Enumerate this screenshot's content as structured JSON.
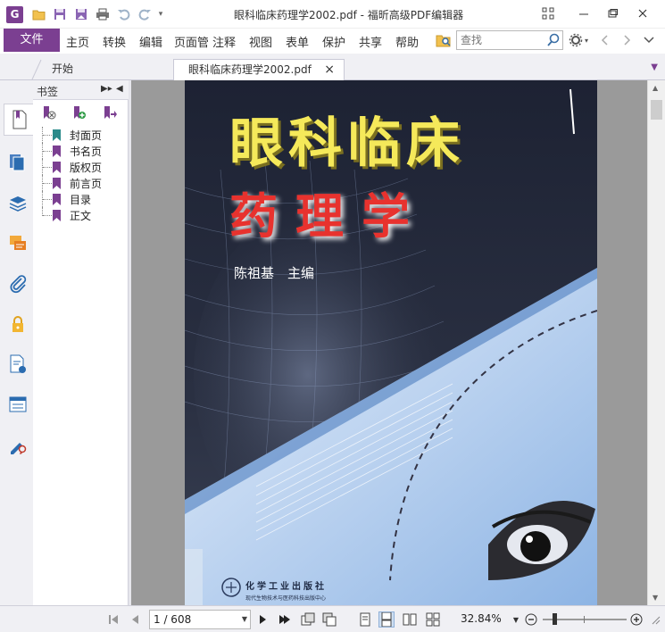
{
  "window": {
    "title": "眼科临床药理学2002.pdf - 福昕高级PDF编辑器",
    "app_logo_letter": "G"
  },
  "ribbon": {
    "file_label": "文件",
    "tabs": [
      "主页",
      "转换",
      "编辑",
      "页面管",
      "注释",
      "视图",
      "表单",
      "保护",
      "共享",
      "帮助"
    ],
    "search_placeholder": "查找"
  },
  "doc_tabs": {
    "home_label": "开始",
    "active_label": "眼科临床药理学2002.pdf",
    "close_glyph": "×"
  },
  "bookmark_panel": {
    "title": "书签",
    "items": [
      "封面页",
      "书名页",
      "版权页",
      "前言页",
      "目录",
      "正文"
    ]
  },
  "cover": {
    "title_line1": "眼科临床",
    "title_line2": "药理学",
    "author": "陈祖基　主编",
    "publisher": "化学工业出版社",
    "publisher_sub": "现代生物技术与医药科技出版中心"
  },
  "statusbar": {
    "page_value": "1 / 608",
    "zoom": "32.84%"
  },
  "colors": {
    "brand_purple": "#7b3f91",
    "ui_gray": "#f0f0f4",
    "doc_background": "#9a9a9a"
  }
}
